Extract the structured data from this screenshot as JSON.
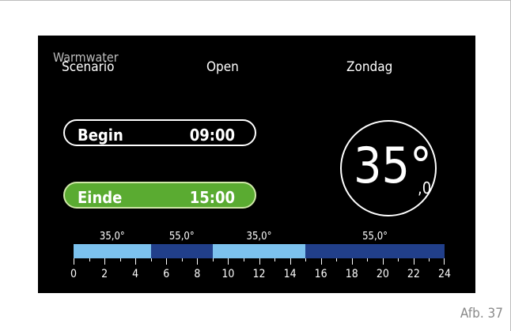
{
  "header": {
    "menu_title": "Warmwater",
    "scenario_label": "Scenario",
    "mode_value": "Open",
    "day_value": "Zondag"
  },
  "schedule": {
    "begin_label": "Begin",
    "begin_time": "09:00",
    "end_label": "Einde",
    "end_time": "15:00"
  },
  "temperature": {
    "main": "35°",
    "decimal": ",0"
  },
  "timeline": {
    "segment_labels": [
      "35,0°",
      "55,0°",
      "35,0°",
      "55,0°"
    ],
    "segments": [
      {
        "from": 0,
        "to": 5,
        "temp": "35,0°",
        "level": "low"
      },
      {
        "from": 5,
        "to": 9,
        "temp": "55,0°",
        "level": "high"
      },
      {
        "from": 9,
        "to": 15,
        "temp": "35,0°",
        "level": "low"
      },
      {
        "from": 15,
        "to": 24,
        "temp": "55,0°",
        "level": "high"
      }
    ],
    "hour_labels": [
      "0",
      "2",
      "4",
      "6",
      "8",
      "10",
      "12",
      "14",
      "16",
      "18",
      "20",
      "22",
      "24"
    ],
    "colors": {
      "low": "#7cc2ee",
      "high": "#213f8a"
    }
  },
  "figure_caption": "Afb. 37"
}
